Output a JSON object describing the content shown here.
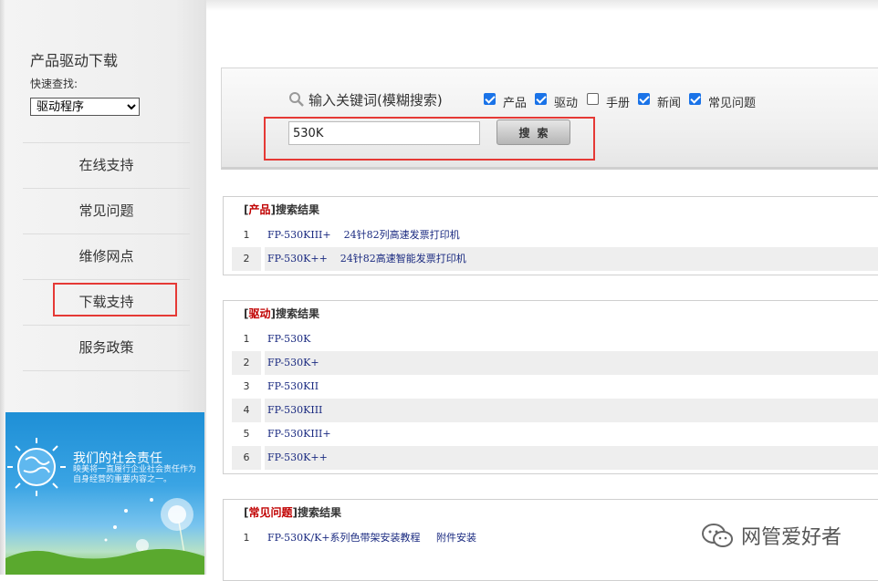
{
  "sidebar": {
    "title": "产品驱动下载",
    "quick_search_label": "快速查找:",
    "select_value": "驱动程序",
    "nav": [
      {
        "label": "在线支持"
      },
      {
        "label": "常见问题"
      },
      {
        "label": "维修网点"
      },
      {
        "label": "下载支持"
      },
      {
        "label": "服务政策"
      }
    ],
    "banner": {
      "title": "我们的社会责任",
      "subtitle": "映美将一直履行企业社会责任作为自身经营的重要内容之一。"
    }
  },
  "search": {
    "title": "输入关键词(模糊搜索)",
    "filters": [
      {
        "label": "产品",
        "checked": true
      },
      {
        "label": "驱动",
        "checked": true
      },
      {
        "label": "手册",
        "checked": false
      },
      {
        "label": "新闻",
        "checked": true
      },
      {
        "label": "常见问题",
        "checked": true
      }
    ],
    "keyword": "530K",
    "button_label": "搜索"
  },
  "results": {
    "product": {
      "category": "产品",
      "suffix": "搜索结果",
      "rows": [
        {
          "num": "1",
          "text": "FP-530KIII+    24针82列高速发票打印机"
        },
        {
          "num": "2",
          "text": "FP-530K++    24针82高速智能发票打印机"
        }
      ]
    },
    "driver": {
      "category": "驱动",
      "suffix": "搜索结果",
      "rows": [
        {
          "num": "1",
          "text": "FP-530K"
        },
        {
          "num": "2",
          "text": "FP-530K+"
        },
        {
          "num": "3",
          "text": "FP-530KII"
        },
        {
          "num": "4",
          "text": "FP-530KIII"
        },
        {
          "num": "5",
          "text": "FP-530KIII+"
        },
        {
          "num": "6",
          "text": "FP-530K++"
        }
      ]
    },
    "faq": {
      "category": "常见问题",
      "suffix": "搜索结果",
      "rows": [
        {
          "num": "1",
          "text": "FP-530K/K+系列色带架安装教程     附件安装"
        }
      ]
    }
  },
  "watermark": {
    "text": "网管爱好者"
  },
  "colors": {
    "highlight": "#e53935",
    "category": "#c00000",
    "link": "#1a2a80",
    "checkbox": "#1a73e8"
  }
}
